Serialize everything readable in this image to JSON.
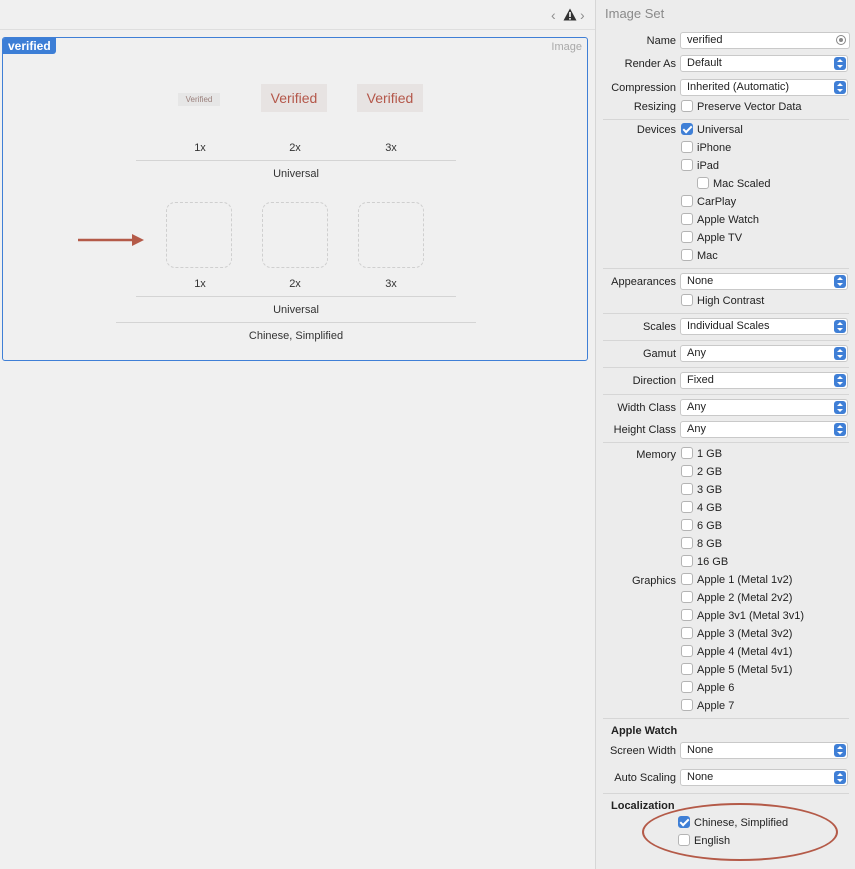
{
  "jumpbar": {
    "back_icon": "chevron-left-icon",
    "warning_icon": "warning-icon",
    "forward_icon": "chevron-right-icon",
    "back_glyph": "‹",
    "forward_glyph": "›"
  },
  "image_set": {
    "name_tag": "verified",
    "type_label": "Image",
    "universal_row": {
      "thumbnails": [
        "Verified",
        "Verified",
        "Verified"
      ],
      "slots": [
        "1x",
        "2x",
        "3x"
      ],
      "group": "Universal"
    },
    "localized_row": {
      "slots": [
        "1x",
        "2x",
        "3x"
      ],
      "group": "Universal",
      "locale": "Chinese, Simplified"
    }
  },
  "inspector": {
    "title": "Image Set",
    "name": {
      "label": "Name",
      "value": "verified"
    },
    "render_as": {
      "label": "Render As",
      "value": "Default"
    },
    "compression": {
      "label": "Compression",
      "value": "Inherited (Automatic)"
    },
    "resizing": {
      "label": "Resizing",
      "option": "Preserve Vector Data",
      "checked": false
    },
    "devices": {
      "label": "Devices",
      "items": [
        {
          "label": "Universal",
          "checked": true
        },
        {
          "label": "iPhone",
          "checked": false
        },
        {
          "label": "iPad",
          "checked": false
        },
        {
          "label": "Mac Scaled",
          "checked": false
        },
        {
          "label": "CarPlay",
          "checked": false
        },
        {
          "label": "Apple Watch",
          "checked": false
        },
        {
          "label": "Apple TV",
          "checked": false
        },
        {
          "label": "Mac",
          "checked": false
        }
      ]
    },
    "appearances": {
      "label": "Appearances",
      "value": "None",
      "high_contrast": "High Contrast"
    },
    "scales": {
      "label": "Scales",
      "value": "Individual Scales"
    },
    "gamut": {
      "label": "Gamut",
      "value": "Any"
    },
    "direction": {
      "label": "Direction",
      "value": "Fixed"
    },
    "width_class": {
      "label": "Width Class",
      "value": "Any"
    },
    "height_class": {
      "label": "Height Class",
      "value": "Any"
    },
    "memory": {
      "label": "Memory",
      "items": [
        "1 GB",
        "2 GB",
        "3 GB",
        "4 GB",
        "6 GB",
        "8 GB",
        "16 GB"
      ]
    },
    "graphics": {
      "label": "Graphics",
      "items": [
        "Apple 1 (Metal 1v2)",
        "Apple 2 (Metal 2v2)",
        "Apple 3v1 (Metal 3v1)",
        "Apple 3 (Metal 3v2)",
        "Apple 4 (Metal 4v1)",
        "Apple 5 (Metal 5v1)",
        "Apple 6",
        "Apple 7"
      ]
    },
    "apple_watch": {
      "title": "Apple Watch",
      "screen_width": {
        "label": "Screen Width",
        "value": "None"
      },
      "auto_scaling": {
        "label": "Auto Scaling",
        "value": "None"
      }
    },
    "localization": {
      "title": "Localization",
      "items": [
        {
          "label": "Chinese, Simplified",
          "checked": true
        },
        {
          "label": "English",
          "checked": false
        }
      ]
    }
  },
  "colors": {
    "accent": "#3f7fd6",
    "annotation": "#b45a48"
  }
}
